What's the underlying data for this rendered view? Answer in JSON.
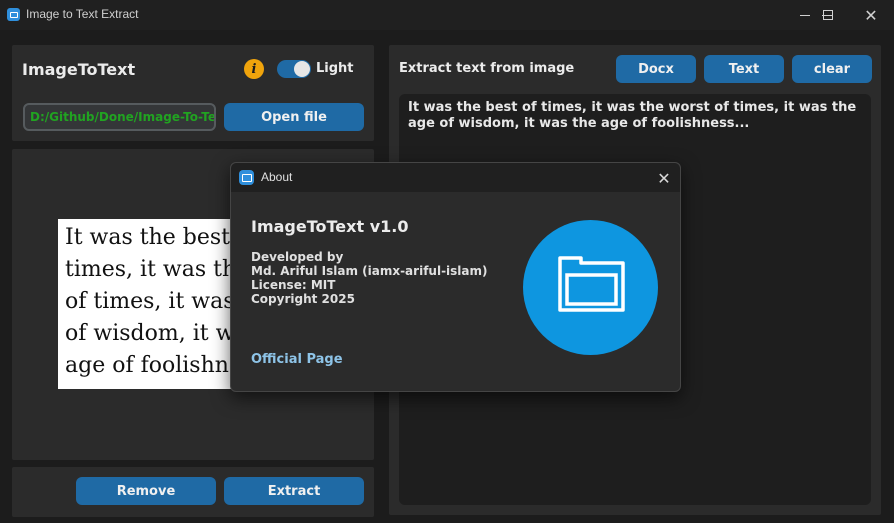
{
  "window": {
    "title": "Image to Text Extract",
    "controls": {
      "minimize": "minimize-icon",
      "maximize": "maximize-icon",
      "close": "close-icon"
    }
  },
  "left_panel": {
    "app_name": "ImageToText",
    "info_icon": "info-icon",
    "theme_label": "Light",
    "theme_toggle_on": true,
    "path_value": "D:/Github/Done/Image-To-Text",
    "open_button": "Open file",
    "preview_text_lines": [
      "It was the best of",
      "times, it was the wor",
      "of times, it was the",
      "of wisdom, it was th",
      "age of foolishness..."
    ],
    "remove_button": "Remove",
    "extract_button": "Extract"
  },
  "right_panel": {
    "heading": "Extract text from image",
    "docx_button": "Docx",
    "text_button": "Text",
    "clear_button": "clear",
    "output_text": "It was the best of times, it was the worst of times, it was the age of wisdom, it was the age of foolishness..."
  },
  "about_dialog": {
    "title": "About",
    "close_icon": "close-icon",
    "app_version": "ImageToText v1.0",
    "lines": [
      "Developed by",
      "Md. Ariful Islam (iamx-ariful-islam)",
      "License: MIT",
      "Copyright 2025"
    ],
    "link": "Official Page",
    "logo_icon": "folder-icon"
  },
  "colors": {
    "accent": "#1f6aa5",
    "path_text": "#21a321",
    "info": "#f0a40c",
    "logo_bg": "#0e96e0",
    "link": "#8ec4e8"
  }
}
